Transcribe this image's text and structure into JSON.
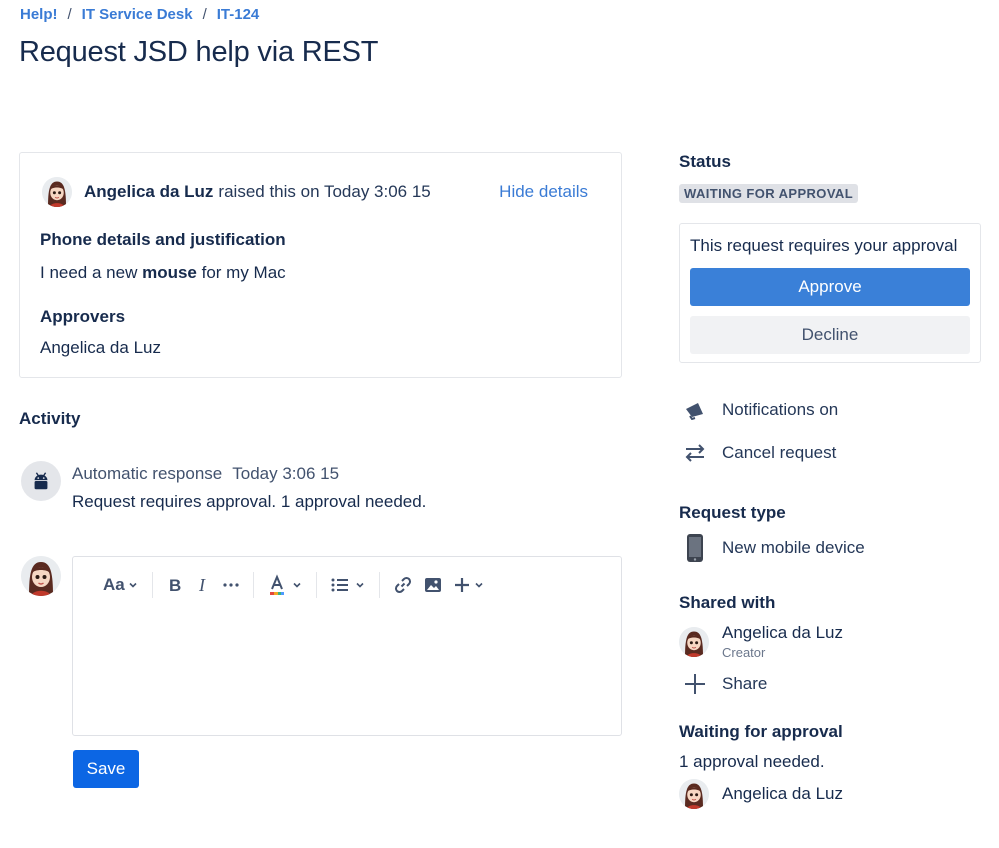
{
  "breadcrumb": {
    "items": [
      "Help!",
      "IT Service Desk",
      "IT-124"
    ],
    "separator": "/"
  },
  "page_title": "Request JSD help via REST",
  "details": {
    "raiser_name": "Angelica da Luz",
    "raised_text": "raised this on Today 3:06 15",
    "hide_details": "Hide details",
    "fields": [
      {
        "label": "Phone details and justification",
        "value_pre": "I need a new ",
        "value_bold": "mouse",
        "value_post": " for my Mac"
      },
      {
        "label": "Approvers",
        "value": "Angelica da Luz"
      }
    ]
  },
  "activity": {
    "title": "Activity",
    "entry": {
      "author": "Automatic response",
      "time": "Today 3:06 15",
      "text": "Request requires approval. 1 approval needed."
    }
  },
  "editor": {
    "text_style": "Aa",
    "save_label": "Save"
  },
  "sidebar": {
    "status_label": "Status",
    "status_value": "WAITING FOR APPROVAL",
    "approval_prompt": "This request requires your approval",
    "approve_label": "Approve",
    "decline_label": "Decline",
    "notifications": "Notifications on",
    "cancel": "Cancel request",
    "request_type_label": "Request type",
    "request_type": "New mobile device",
    "shared_with_label": "Shared with",
    "shared_name": "Angelica da Luz",
    "shared_role": "Creator",
    "share_label": "Share",
    "waiting_label": "Waiting for approval",
    "waiting_text": "1 approval needed.",
    "approver_name": "Angelica da Luz"
  },
  "colors": {
    "link": "#3a7bd5",
    "primary": "#0c66e4",
    "approve": "#3a80d8",
    "text": "#172b4d"
  },
  "icons": [
    "avatar",
    "android-icon",
    "bold-icon",
    "italic-icon",
    "more-icon",
    "text-color-icon",
    "list-icon",
    "link-icon",
    "image-icon",
    "plus-icon",
    "megaphone-icon",
    "transfer-icon",
    "phone-icon"
  ]
}
